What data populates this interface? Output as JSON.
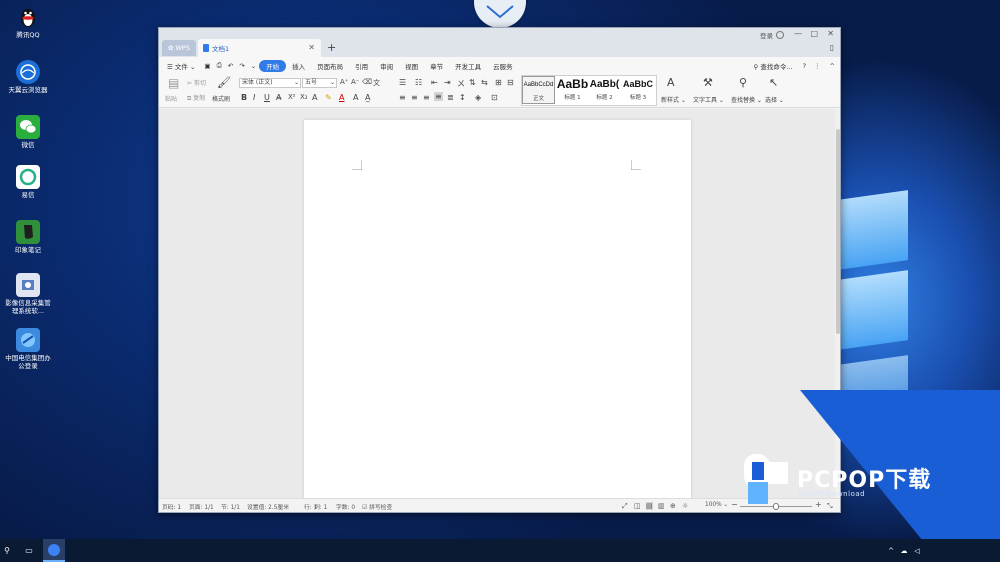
{
  "desktop": {
    "icons": [
      {
        "label": "腾讯QQ",
        "icon": "qq-penguin-icon"
      },
      {
        "label": "天翼云浏览器",
        "icon": "browser-globe-icon"
      },
      {
        "label": "微信",
        "icon": "wechat-icon"
      },
      {
        "label": "易信",
        "icon": "yixin-icon"
      },
      {
        "label": "印象笔记",
        "icon": "evernote-icon"
      },
      {
        "label": "影像信息采集管理系统软...",
        "icon": "image-capture-icon"
      },
      {
        "label": "中国电信集团办公登录",
        "icon": "telecom-office-icon"
      }
    ],
    "watermark": {
      "brand": "PCPOP下载",
      "sub": "PCPOP Download"
    }
  },
  "window": {
    "tab_wps": "WPS",
    "tab_doc": "文档1",
    "login": "登录",
    "menu": [
      "文件",
      "开始",
      "插入",
      "页面布局",
      "引用",
      "审阅",
      "视图",
      "章节",
      "开发工具",
      "云服务"
    ],
    "search": "查找命令...",
    "ribbon": {
      "paste": "粘贴",
      "cut": "剪切",
      "copy": "复制",
      "format_painter": "格式刷",
      "font_name": "宋体 (正文)",
      "font_size": "五号",
      "styles": [
        {
          "sample": "AaBbCcDd",
          "label": "正文"
        },
        {
          "sample": "AaBb",
          "label": "标题 1"
        },
        {
          "sample": "AaBb(",
          "label": "标题 2"
        },
        {
          "sample": "AaBbC",
          "label": "标题 3"
        }
      ],
      "new_style": "新样式",
      "text_tools": "文字工具",
      "find_replace": "查找替换",
      "select": "选择"
    },
    "status": {
      "page_no": "页码: 1",
      "pages": "页面: 1/1",
      "section": "节: 1/1",
      "setting": "设置值: 2.5厘米",
      "row": "行: 1",
      "col": "列: 1",
      "words": "字数: 0",
      "spellcheck": "拼写检查",
      "zoom": "100%"
    }
  }
}
